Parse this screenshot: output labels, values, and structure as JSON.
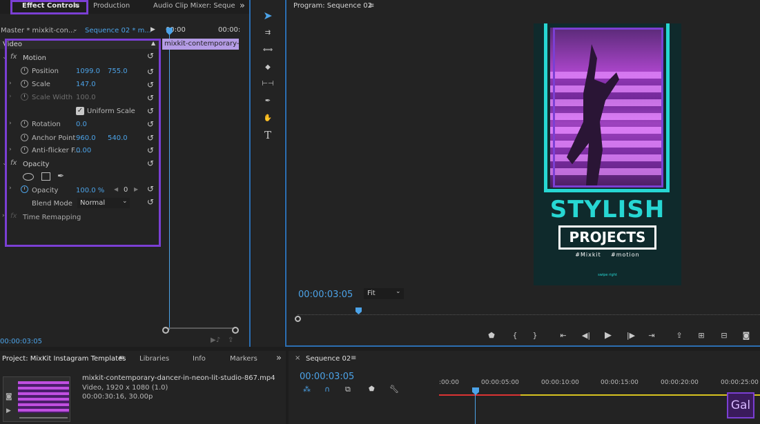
{
  "colors": {
    "accent": "#4ca3e8",
    "highlight_box": "#7b3fd4",
    "clip": "#a78de0",
    "cyan": "#27d7d3"
  },
  "effect_panel": {
    "tabs": [
      "Effect Controls",
      "Production",
      "Audio Clip Mixer: Seque"
    ],
    "overflow": "»",
    "master_label": "Master * mixkit-con...",
    "sequence_label": "Sequence 02 * m...",
    "timecode_left": "00:00",
    "timecode_right": "00:00:",
    "clip_name": "mixkit-contemporary-da",
    "section_video": "Video",
    "motion": {
      "label": "Motion",
      "position_label": "Position",
      "position_x": "1099.0",
      "position_y": "755.0",
      "scale_label": "Scale",
      "scale_value": "147.0",
      "scale_width_label": "Scale Width",
      "scale_width_value": "100.0",
      "uniform_label": "Uniform Scale",
      "rotation_label": "Rotation",
      "rotation_value": "0.0",
      "anchor_label": "Anchor Point",
      "anchor_x": "960.0",
      "anchor_y": "540.0",
      "antiflicker_label": "Anti-flicker F...",
      "antiflicker_value": "0.00"
    },
    "opacity": {
      "label": "Opacity",
      "opacity_label": "Opacity",
      "opacity_value": "100.0 %",
      "keyframe_value": "0",
      "blend_label": "Blend Mode",
      "blend_value": "Normal"
    },
    "time_remap_label": "Time Remapping",
    "footer_time": "00:00:03:05"
  },
  "program": {
    "title": "Program: Sequence 02",
    "video_text_1": "STYLISH",
    "video_text_2": "PROJECTS",
    "video_text_3": "#Mixkit    #motion",
    "video_text_4": "swipe right",
    "timecode": "00:00:03:05",
    "fit": "Fit"
  },
  "project": {
    "tabs": [
      "Project: MixKit Instagram Templates",
      "Libraries",
      "Info",
      "Markers"
    ],
    "overflow": "»",
    "file_name": "mixkit-contemporary-dancer-in-neon-lit-studio-867.mp4",
    "file_info1": "Video, 1920 x 1080 (1.0)",
    "file_info2": "00:00:30:16, 30.00p"
  },
  "timeline": {
    "tab": "Sequence 02",
    "timecode": "00:00:03:05",
    "ruler": [
      ":00:00",
      "00:00:05:00",
      "00:00:10:00",
      "00:00:15:00",
      "00:00:20:00",
      "00:00:25:00"
    ],
    "watermark": "Gal"
  }
}
